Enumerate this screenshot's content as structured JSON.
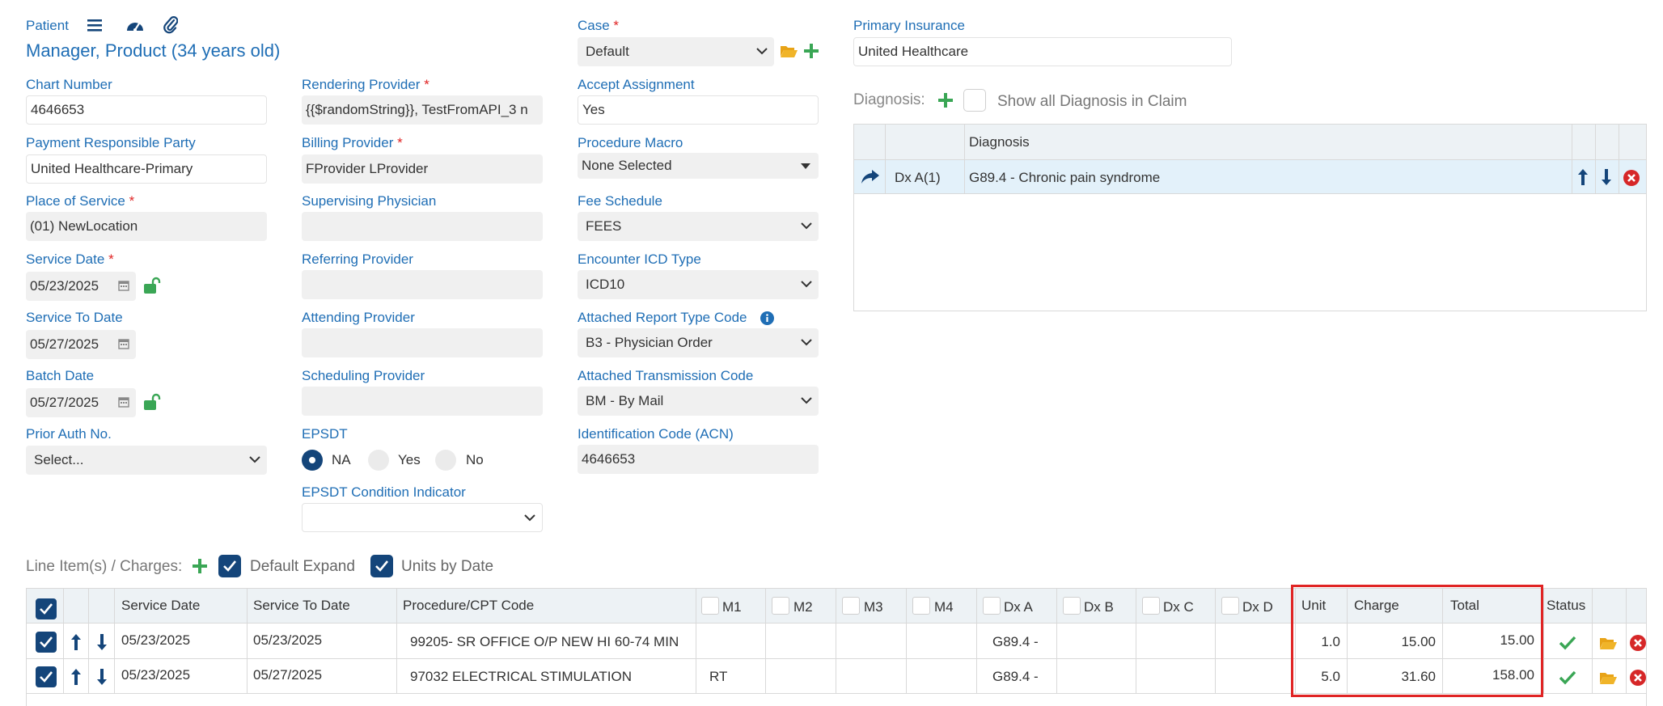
{
  "patient": {
    "label": "Patient",
    "name": "Manager, Product (34 years old)",
    "chart_number_label": "Chart Number",
    "chart_number": "4646653",
    "payment_party_label": "Payment Responsible Party",
    "payment_party": "United Healthcare-Primary",
    "place_of_service_label": "Place of Service",
    "place_of_service": "(01) NewLocation",
    "service_date_label": "Service Date",
    "service_date": "05/23/2025",
    "service_to_date_label": "Service To Date",
    "service_to_date": "05/27/2025",
    "batch_date_label": "Batch Date",
    "batch_date": "05/27/2025",
    "prior_auth_label": "Prior Auth No.",
    "prior_auth": "Select..."
  },
  "providers": {
    "rendering_label": "Rendering Provider",
    "rendering": "{{$randomString}}, TestFromAPI_3 n",
    "billing_label": "Billing Provider",
    "billing": "FProvider LProvider",
    "supervising_label": "Supervising Physician",
    "referring_label": "Referring Provider",
    "attending_label": "Attending Provider",
    "scheduling_label": "Scheduling Provider",
    "epsdt_label": "EPSDT",
    "epsdt_options": [
      "NA",
      "Yes",
      "No"
    ],
    "epsdt_condition_label": "EPSDT Condition Indicator"
  },
  "case": {
    "case_label": "Case",
    "case_value": "Default",
    "accept_assignment_label": "Accept Assignment",
    "accept_assignment": "Yes",
    "procedure_macro_label": "Procedure Macro",
    "procedure_macro": "None Selected",
    "fee_schedule_label": "Fee Schedule",
    "fee_schedule": "FEES",
    "encounter_icd_label": "Encounter ICD Type",
    "encounter_icd": "ICD10",
    "report_type_label": "Attached Report Type Code",
    "report_type": "B3 - Physician Order",
    "transmission_label": "Attached Transmission Code",
    "transmission": "BM - By Mail",
    "acn_label": "Identification Code (ACN)",
    "acn": "4646653"
  },
  "insurance": {
    "primary_label": "Primary Insurance",
    "primary": "United Healthcare"
  },
  "diagnosis": {
    "label": "Diagnosis:",
    "show_all_label": "Show all Diagnosis in Claim",
    "column_header": "Diagnosis",
    "rows": [
      {
        "code": "Dx A(1)",
        "description": "G89.4 - Chronic pain syndrome"
      }
    ]
  },
  "line_items": {
    "label": "Line Item(s) / Charges:",
    "default_expand_label": "Default Expand",
    "units_by_date_label": "Units by Date",
    "headers": {
      "service_date": "Service Date",
      "service_to_date": "Service To Date",
      "procedure": "Procedure/CPT Code",
      "m1": "M1",
      "m2": "M2",
      "m3": "M3",
      "m4": "M4",
      "dxa": "Dx A",
      "dxb": "Dx B",
      "dxc": "Dx C",
      "dxd": "Dx D",
      "unit": "Unit",
      "charge": "Charge",
      "total": "Total",
      "status": "Status"
    },
    "rows": [
      {
        "service_date": "05/23/2025",
        "service_to_date": "05/23/2025",
        "procedure": "99205- SR OFFICE O/P NEW HI 60-74 MIN",
        "m1": "",
        "dxa": "G89.4 -",
        "unit": "1.0",
        "charge": "15.00",
        "total": "15.00"
      },
      {
        "service_date": "05/23/2025",
        "service_to_date": "05/27/2025",
        "procedure": "97032 ELECTRICAL STIMULATION",
        "m1": "RT",
        "dxa": "G89.4 -",
        "unit": "5.0",
        "charge": "31.60",
        "total": "158.00"
      }
    ]
  },
  "colors": {
    "label_blue": "#1f6eb5",
    "navy": "#14457a",
    "green": "#3aa655",
    "orange": "#e8a317",
    "red": "#d62728",
    "highlight": "#e02424"
  }
}
